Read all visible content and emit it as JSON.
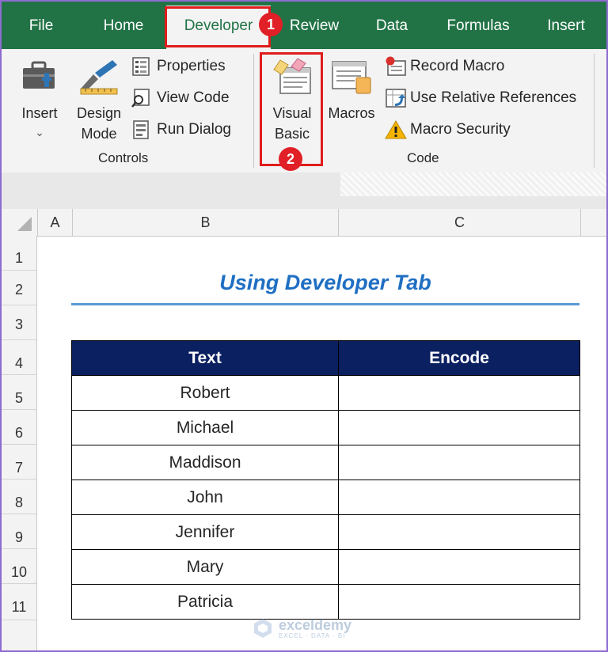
{
  "tabs": [
    "File",
    "Home",
    "Developer",
    "Review",
    "Data",
    "Formulas",
    "Insert"
  ],
  "active_tab": "Developer",
  "ribbon": {
    "controls": {
      "insert_label": "Insert",
      "insert_caret": "⌄",
      "design_mode_line1": "Design",
      "design_mode_line2": "Mode",
      "properties": "Properties",
      "view_code": "View Code",
      "run_dialog": "Run Dialog",
      "group_label": "Controls"
    },
    "code": {
      "visual_basic_line1": "Visual",
      "visual_basic_line2": "Basic",
      "macros": "Macros",
      "record_macro": "Record Macro",
      "use_relative_references": "Use Relative References",
      "macro_security": "Macro Security",
      "group_label": "Code"
    }
  },
  "annotations": {
    "step1": "1",
    "step2": "2",
    "highlight_color": "#e01c1c"
  },
  "sheet": {
    "columns": [
      "A",
      "B",
      "C"
    ],
    "rows": [
      "1",
      "2",
      "3",
      "4",
      "5",
      "6",
      "7",
      "8",
      "9",
      "10",
      "11"
    ],
    "title": "Using Developer Tab",
    "table": {
      "headers": [
        "Text",
        "Encode"
      ],
      "rows": [
        [
          "Robert",
          ""
        ],
        [
          "Michael",
          ""
        ],
        [
          "Maddison",
          ""
        ],
        [
          "John",
          ""
        ],
        [
          "Jennifer",
          ""
        ],
        [
          "Mary",
          ""
        ],
        [
          "Patricia",
          ""
        ]
      ]
    }
  },
  "watermark": {
    "name": "exceldemy",
    "tagline": "EXCEL · DATA · BI"
  },
  "colors": {
    "ribbon_green": "#217346",
    "header_navy": "#0b2060",
    "title_blue": "#1f6fc3",
    "frame_purple": "#8e6bd1"
  }
}
